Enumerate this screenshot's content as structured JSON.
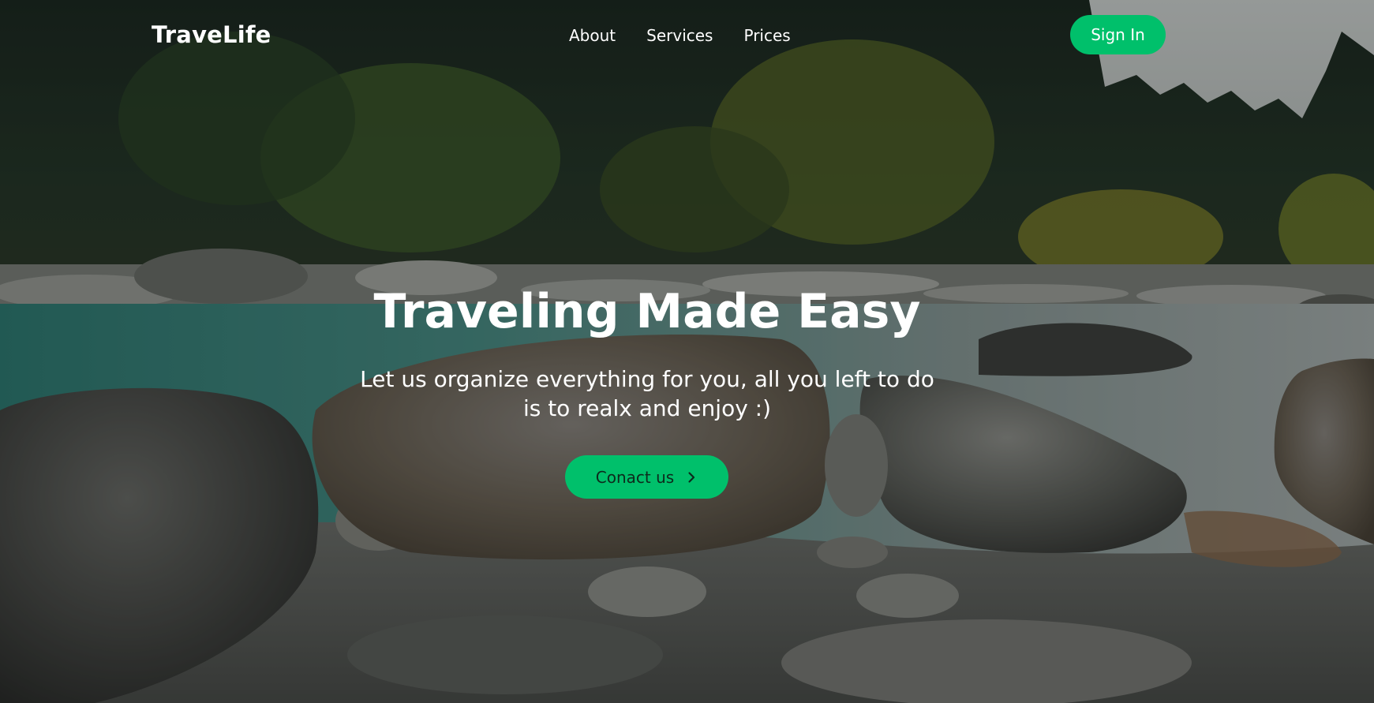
{
  "brand": {
    "logo": "TraveLife",
    "accent": "#00c06b"
  },
  "nav": {
    "links": [
      {
        "label": "About"
      },
      {
        "label": "Services"
      },
      {
        "label": "Prices"
      }
    ],
    "signin_label": "Sign In"
  },
  "hero": {
    "headline": "Traveling Made Easy",
    "subtitle": "Let us organize everything for you, all you left to do is to realx and enjoy :)",
    "cta_label": "Conact us",
    "cta_icon": "chevron-right-icon"
  },
  "background": {
    "icon": "river-landscape-photo"
  }
}
